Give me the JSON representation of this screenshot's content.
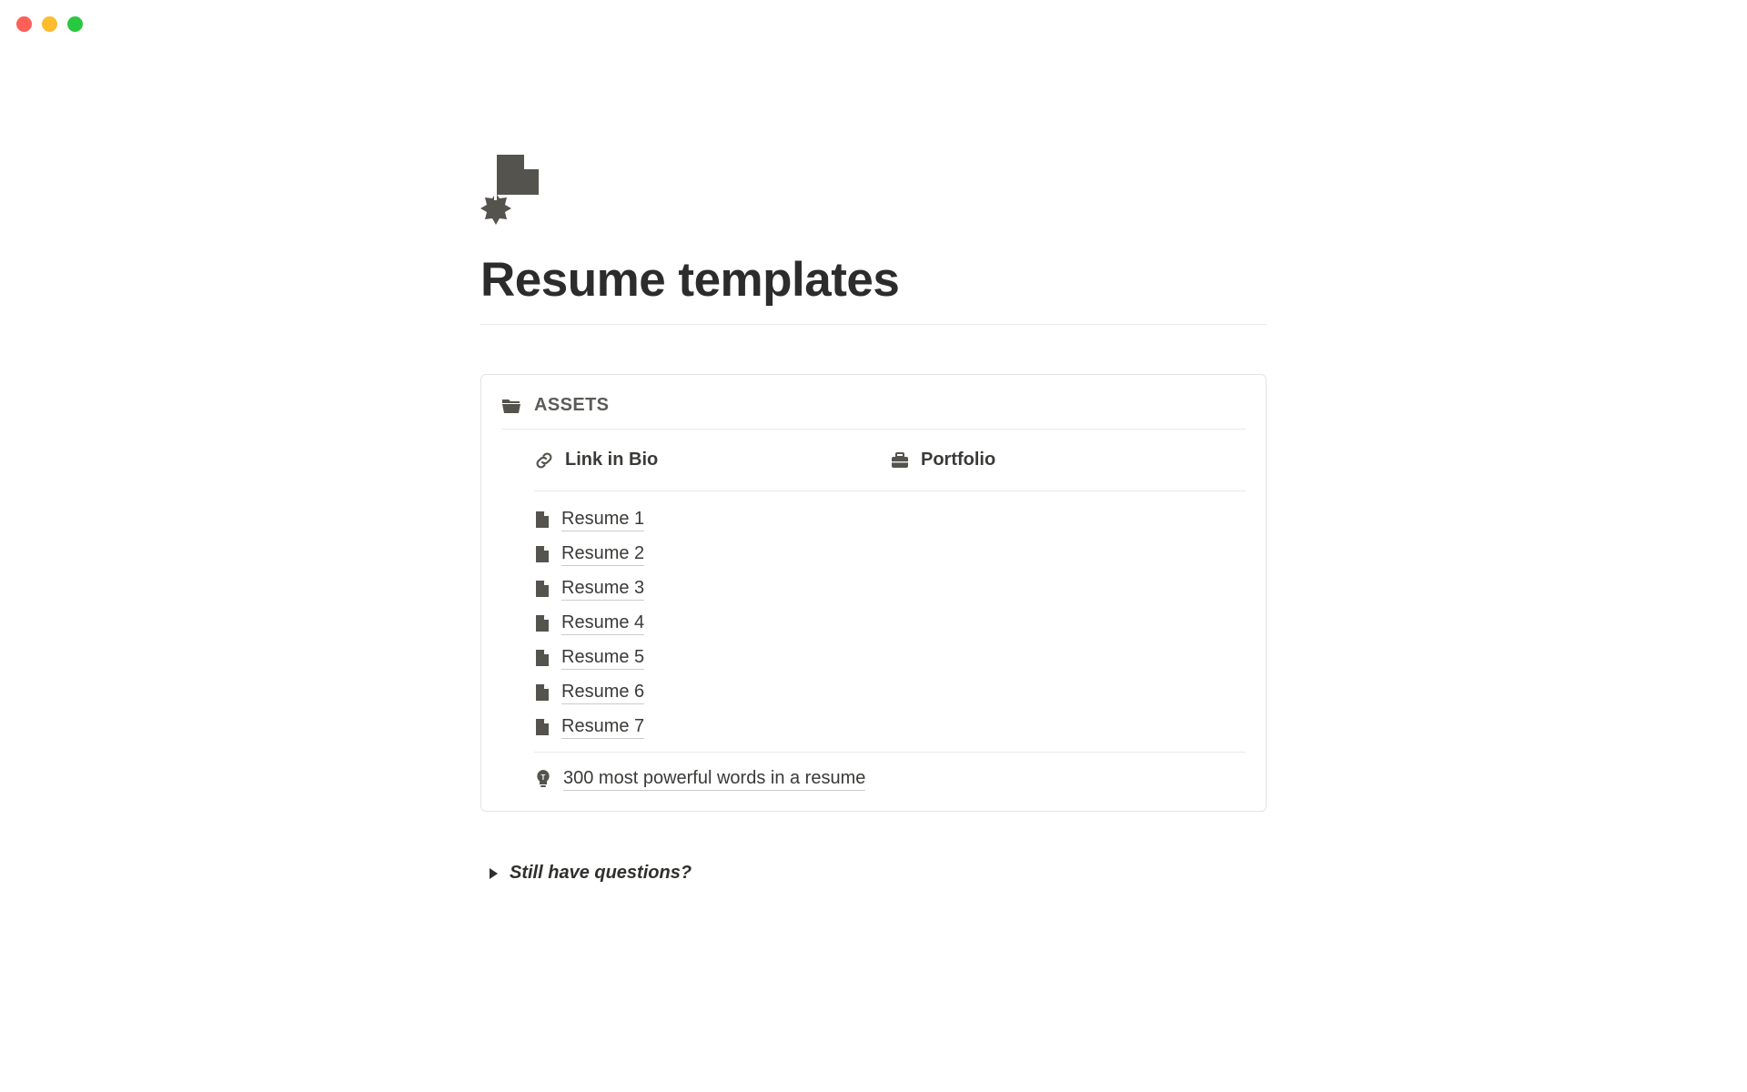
{
  "page": {
    "title": "Resume templates"
  },
  "assets": {
    "header_label": "ASSETS",
    "top_links": [
      {
        "label": "Link in Bio"
      },
      {
        "label": "Portfolio"
      }
    ],
    "resumes": [
      {
        "label": "Resume 1"
      },
      {
        "label": "Resume 2"
      },
      {
        "label": "Resume 3"
      },
      {
        "label": "Resume 4"
      },
      {
        "label": "Resume 5"
      },
      {
        "label": "Resume 6"
      },
      {
        "label": "Resume 7"
      }
    ],
    "tip": {
      "label": "300 most powerful words in a resume"
    }
  },
  "toggle": {
    "label": "Still have questions?"
  }
}
